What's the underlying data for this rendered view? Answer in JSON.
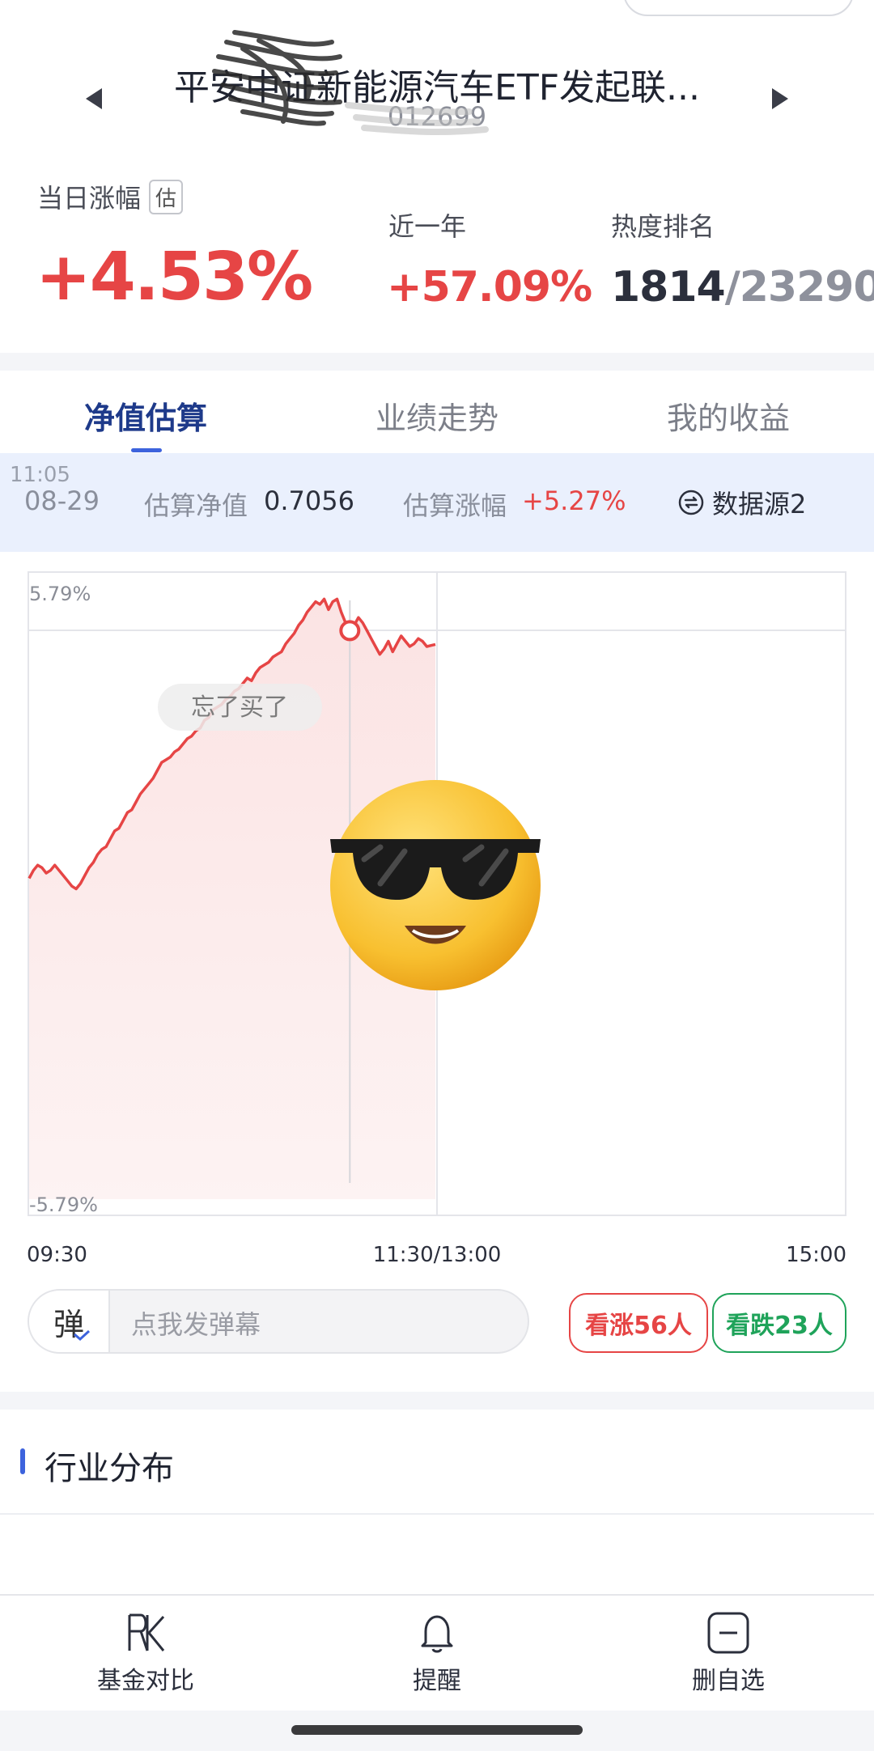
{
  "header": {
    "fund_name": "平安中证新能源汽车ETF发起联...",
    "fund_code": "012699",
    "today_label": "当日涨幅",
    "estimate_badge": "估",
    "today_change": "+4.53%",
    "year_label": "近一年",
    "year_change": "+57.09%",
    "rank_label": "热度排名",
    "rank_current": "1814",
    "rank_total": "/23290"
  },
  "tabs": [
    "净值估算",
    "业绩走势",
    "我的收益"
  ],
  "infobar": {
    "time": "11:05",
    "date": "08-29",
    "nav_label": "估算净值",
    "nav_value": "0.7056",
    "change_label": "估算涨幅",
    "change_value": "+5.27%",
    "source_label": "数据源2"
  },
  "chart_data": {
    "type": "line",
    "ymax_label": "5.79%",
    "ymin_label": "-5.79%",
    "ylim": [
      -5.79,
      5.79
    ],
    "x_ticks": [
      "09:30",
      "11:30/13:00",
      "15:00"
    ],
    "series": [
      {
        "values": [
          0.3,
          0.45,
          0.55,
          0.5,
          0.4,
          0.45,
          0.55,
          0.45,
          0.35,
          0.25,
          0.15,
          0.1,
          0.2,
          0.35,
          0.5,
          0.6,
          0.75,
          0.85,
          0.9,
          1.05,
          1.2,
          1.25,
          1.4,
          1.55,
          1.6,
          1.75,
          1.9,
          2.0,
          2.1,
          2.2,
          2.35,
          2.5,
          2.55,
          2.6,
          2.7,
          2.75,
          2.85,
          2.95,
          3.0,
          3.1,
          3.15,
          3.3,
          3.35,
          3.5,
          3.55,
          3.6,
          3.7,
          3.75,
          3.85,
          3.9,
          4.0,
          4.1,
          4.05,
          4.2,
          4.3,
          4.35,
          4.4,
          4.5,
          4.55,
          4.6,
          4.75,
          4.85,
          4.95,
          5.1,
          5.2,
          5.35,
          5.45,
          5.55,
          5.5,
          5.6,
          5.4,
          5.55,
          5.6,
          5.35,
          5.15,
          5.0,
          5.1,
          5.25,
          5.15,
          5.0,
          4.85,
          4.7,
          4.55,
          4.65,
          4.8,
          4.6,
          4.75,
          4.9,
          4.8,
          4.7,
          4.75,
          4.85,
          4.8,
          4.7,
          4.72,
          4.74
        ]
      }
    ],
    "marker_label": "忘了买了",
    "current_index": 75
  },
  "controls": {
    "danmu_icon": "弹",
    "danmu_placeholder": "点我发弹幕",
    "bull_label": "看涨56人",
    "bear_label": "看跌23人"
  },
  "industry": {
    "title": "行业分布"
  },
  "bottom_nav": [
    {
      "label": "基金对比",
      "icon": "compare-icon"
    },
    {
      "label": "提醒",
      "icon": "bell-icon"
    },
    {
      "label": "删自选",
      "icon": "remove-watchlist-icon"
    }
  ],
  "colors": {
    "up": "#e64545",
    "down": "#1fa35a",
    "accent": "#3d63dd",
    "infobar_bg": "#eaf0fd"
  }
}
